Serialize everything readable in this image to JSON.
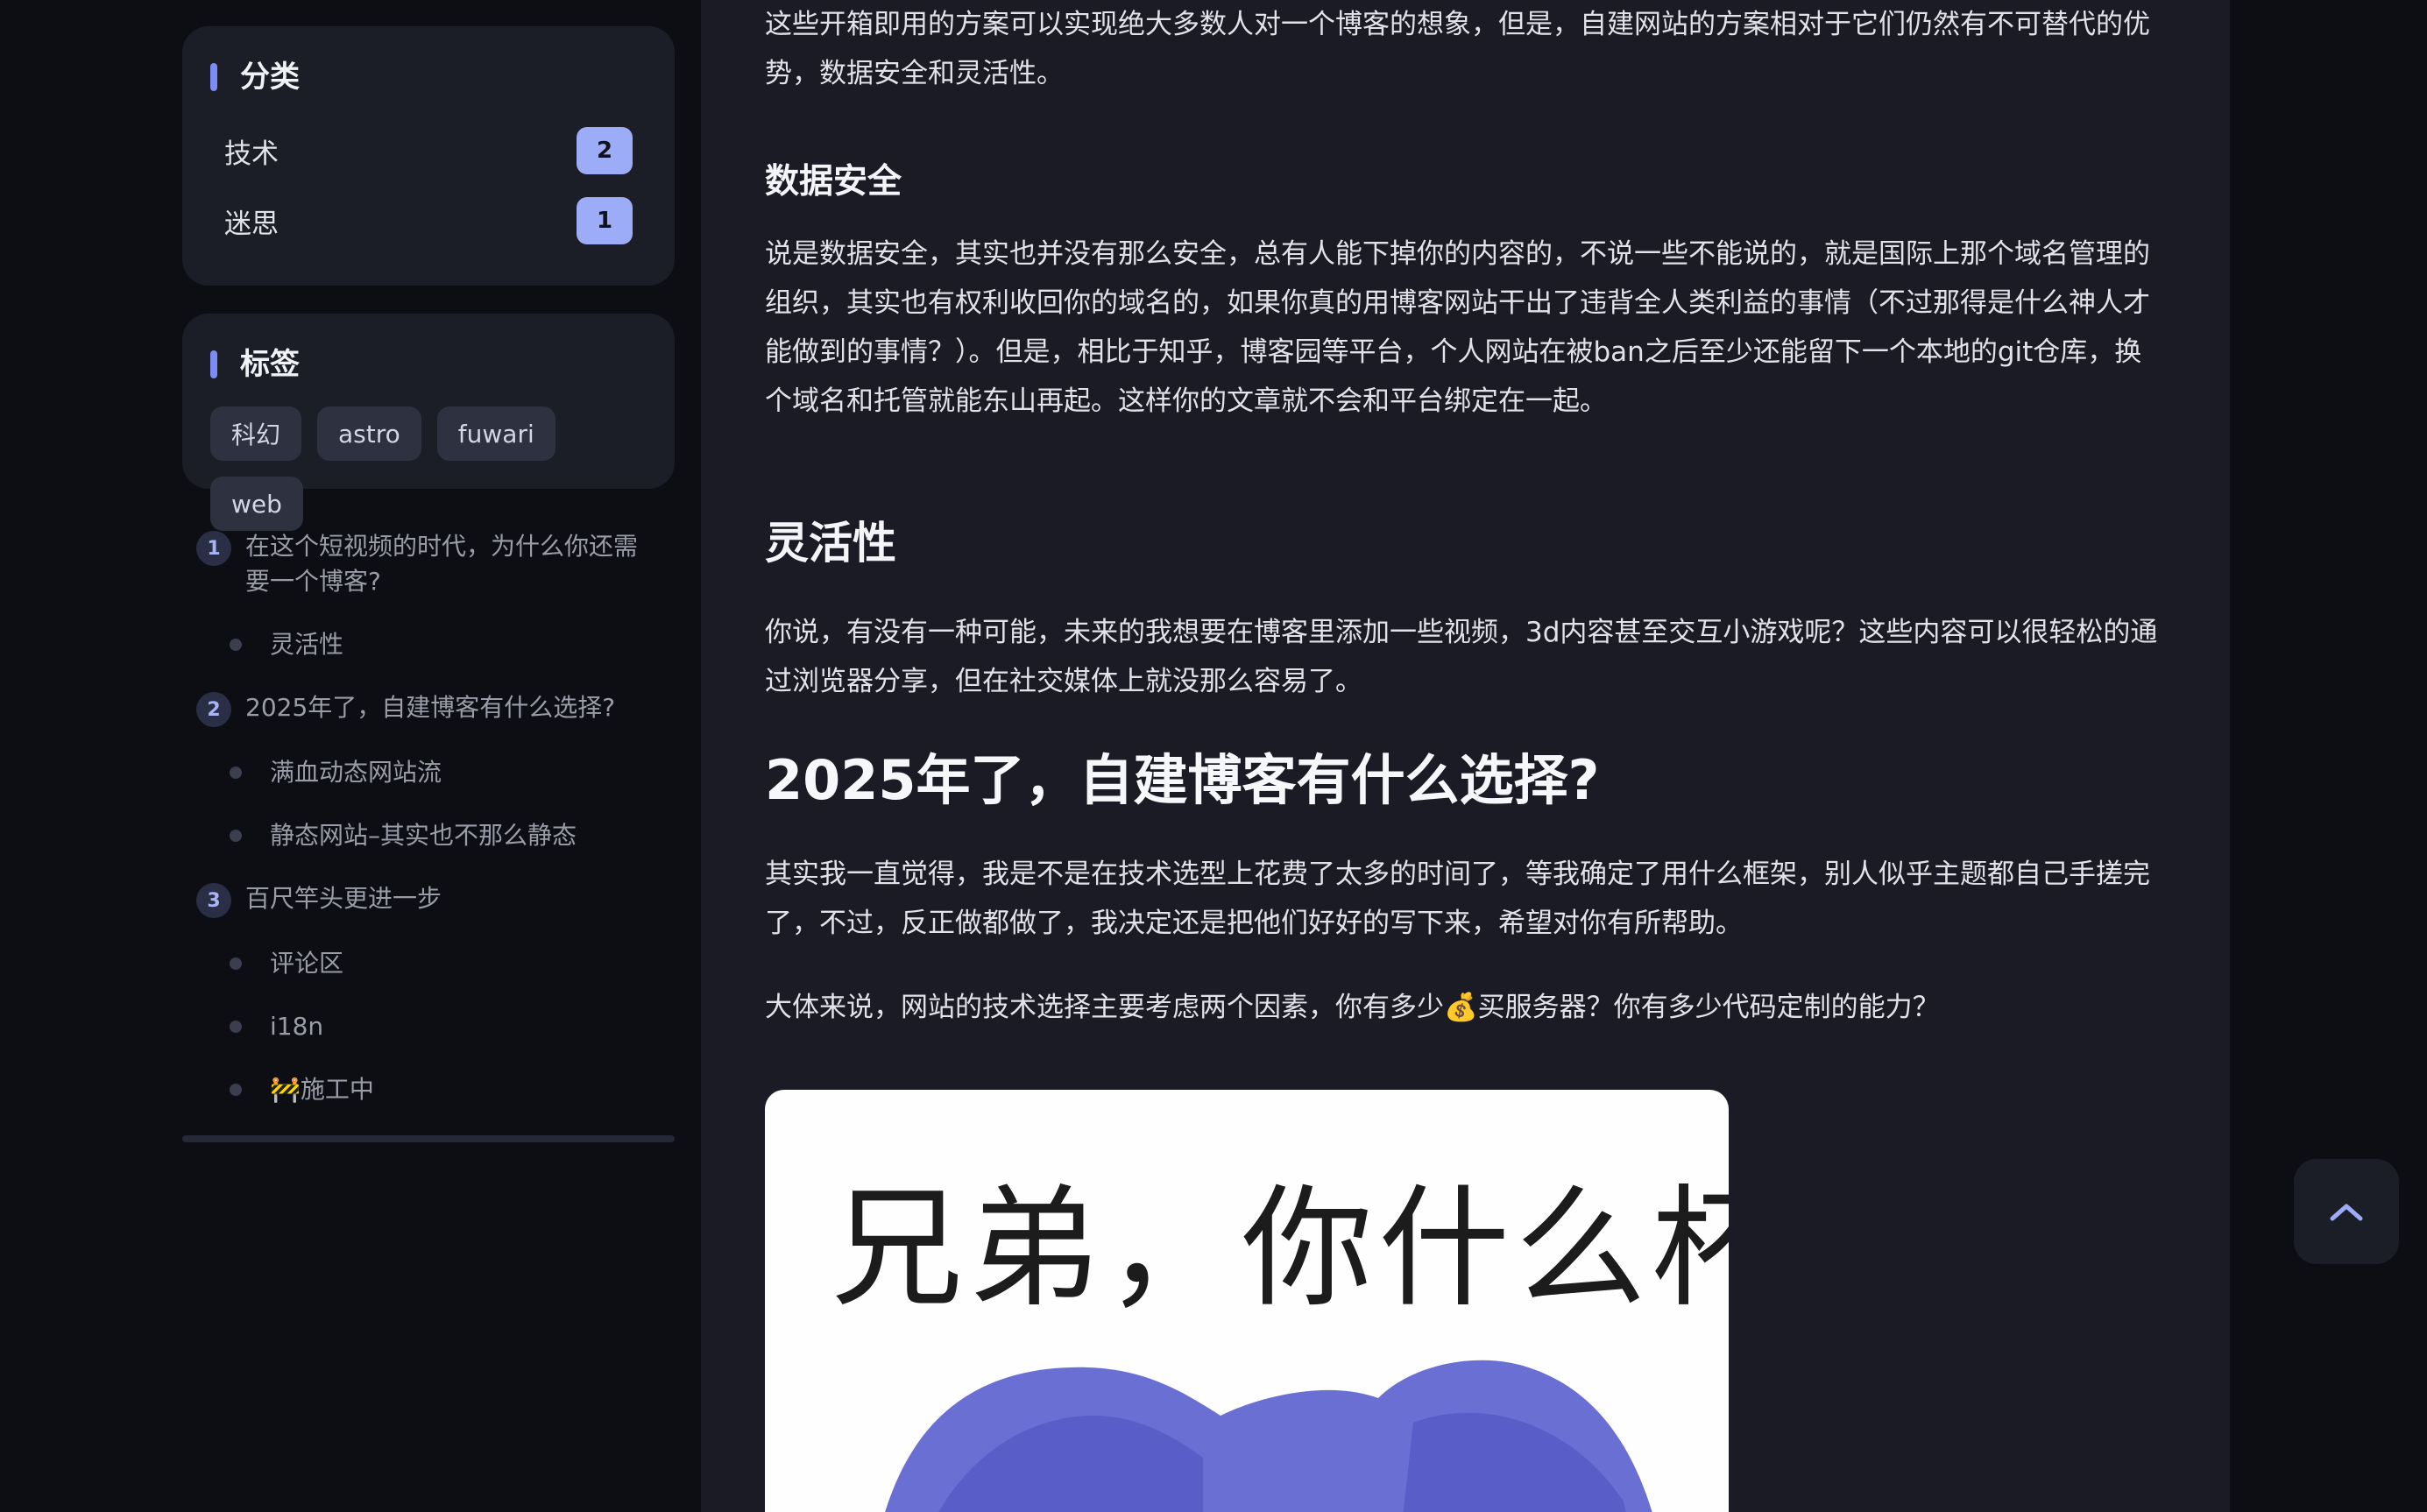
{
  "sidebar": {
    "categories": {
      "title": "分类",
      "items": [
        {
          "label": "技术",
          "count": "2"
        },
        {
          "label": "迷思",
          "count": "1"
        }
      ]
    },
    "tags": {
      "title": "标签",
      "items": [
        "科幻",
        "astro",
        "fuwari",
        "web"
      ]
    },
    "toc": [
      {
        "num": "1",
        "label": "在这个短视频的时代，为什么你还需要一个博客?",
        "children": [
          "灵活性"
        ]
      },
      {
        "num": "2",
        "label": "2025年了，自建博客有什么选择?",
        "children": [
          "满血动态网站流",
          "静态网站–其实也不那么静态"
        ]
      },
      {
        "num": "3",
        "label": "百尺竿头更进一步",
        "children": [
          "评论区",
          "i18n",
          "🚧施工中"
        ]
      }
    ]
  },
  "article": {
    "p_intro": "这些开箱即用的方案可以实现绝大多数人对一个博客的想象，但是，自建网站的方案相对于它们仍然有不可替代的优势，数据安全和灵活性。",
    "h_data_security": "数据安全",
    "p_data_security": "说是数据安全，其实也并没有那么安全，总有人能下掉你的内容的，不说一些不能说的，就是国际上那个域名管理的组织，其实也有权利收回你的域名的，如果你真的用博客网站干出了违背全人类利益的事情（不过那得是什么神人才能做到的事情？）。但是，相比于知乎，博客园等平台，个人网站在被ban之后至少还能留下一个本地的git仓库，换个域名和托管就能东山再起。这样你的文章就不会和平台绑定在一起。",
    "h_flexibility": "灵活性",
    "p_flexibility": "你说，有没有一种可能，未来的我想要在博客里添加一些视频，3d内容甚至交互小游戏呢？这些内容可以很轻松的通过浏览器分享，但在社交媒体上就没那么容易了。",
    "h_2025": "2025年了，自建博客有什么选择?",
    "p_choice_1": "其实我一直觉得，我是不是在技术选型上花费了太多的时间了，等我确定了用什么框架，别人似乎主题都自己手搓完了，不过，反正做都做了，我决定还是把他们好好的写下来，希望对你有所帮助。",
    "p_choice_2": "大体来说，网站的技术选择主要考虑两个因素，你有多少💰买服务器？你有多少代码定制的能力？",
    "meme_caption": "兄弟，你什么杯"
  },
  "icons": {
    "back_to_top": "chevron-up-icon"
  },
  "colors": {
    "accent": "#7b8cf5",
    "badge": "#9cacf7",
    "background": "#0d0e13",
    "card": "#1c1e27",
    "article_bg": "#1a1b24"
  }
}
